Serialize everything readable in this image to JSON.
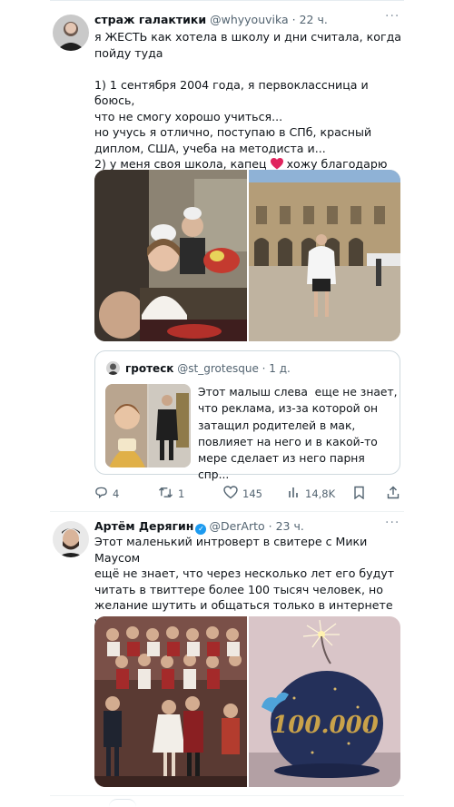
{
  "tweet1": {
    "name": "страж галактики",
    "handle": "@whyyouvika",
    "time": "· 22 ч.",
    "more": "···",
    "text": "я ЖЕСТЬ как хотела в школу и дни считала, когда\nпойду туда\n\n1) 1 сентября 2004 года, я первоклассница и боюсь,\nчто не смогу хорошо учиться...\nно учусь я отлично, поступаю в СПб, красный\nдиплом, США, учеба на методиста и...\n2) у меня своя школа, капец",
    "text_end": " хожу благодарю\nсебя и жизнь",
    "quote": {
      "name": "гротеск",
      "handle": "@st_grotesque",
      "time": "· 1 д.",
      "text": "Этот малыш слева  еще не знает,\nчто реклама, из-за которой он\nзатащил родителей в мак,\nповлияет на него и в какой-то\nмере сделает из него парня спр..."
    },
    "actions": {
      "replies": "4",
      "retweets": "1",
      "likes": "145",
      "views": "14,8K"
    }
  },
  "tweet2": {
    "name": "Артём Дерягин",
    "handle": "@DerArto",
    "time": "· 23 ч.",
    "more": "···",
    "text": "Этот маленький интроверт в свитере с Мики Маусом\nещё не знает, что через несколько лет его будут\nчитать в твиттере более 100 тысяч человек, но\nжелание шутить и общаться только в интернете уже\nпрослеживается",
    "cake_text": "100.000"
  },
  "colors": {
    "accent": "#1d9bf0",
    "heart": "#e0245e",
    "secondary_text": "#536471"
  }
}
